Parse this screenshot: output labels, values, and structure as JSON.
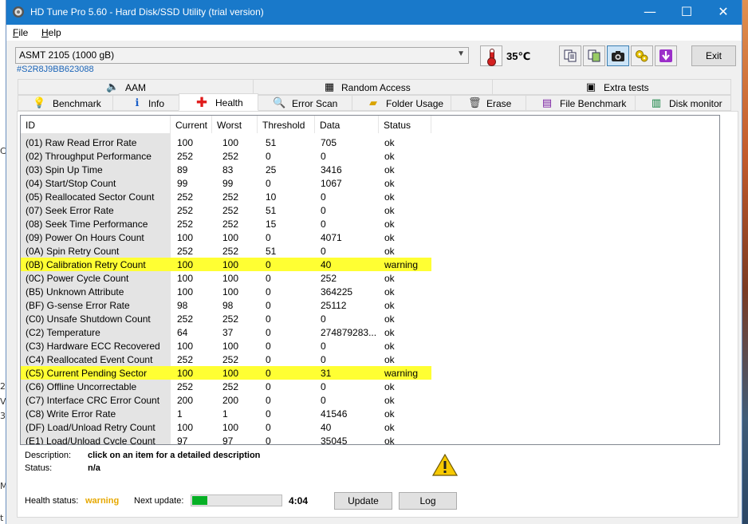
{
  "window": {
    "title": "HD Tune Pro 5.60 - Hard Disk/SSD Utility (trial version)",
    "minimize": "—",
    "maximize": "☐",
    "close": "✕"
  },
  "menu": {
    "file": "File",
    "help": "Help"
  },
  "drive": {
    "name": "ASMT    2105 (1000 gB)",
    "serial": "#S2R8J9BB623088",
    "temperature": "35℃"
  },
  "toolbar": {
    "exit_label": "Exit"
  },
  "tabs_top": [
    {
      "label": "AAM",
      "icon": "speaker-icon"
    },
    {
      "label": "Random Access",
      "icon": "random-access-icon"
    },
    {
      "label": "Extra tests",
      "icon": "extra-tests-icon"
    }
  ],
  "tabs_bottom": [
    {
      "label": "Benchmark",
      "icon": "lightbulb-icon"
    },
    {
      "label": "Info",
      "icon": "info-icon"
    },
    {
      "label": "Health",
      "icon": "health-cross-icon",
      "active": true
    },
    {
      "label": "Error Scan",
      "icon": "magnifier-icon"
    },
    {
      "label": "Folder Usage",
      "icon": "folder-icon"
    },
    {
      "label": "Erase",
      "icon": "trash-icon"
    },
    {
      "label": "File Benchmark",
      "icon": "file-benchmark-icon"
    },
    {
      "label": "Disk monitor",
      "icon": "disk-monitor-icon"
    }
  ],
  "grid": {
    "headers": [
      "ID",
      "Current",
      "Worst",
      "Threshold",
      "Data",
      "Status"
    ],
    "rows": [
      [
        "(01) Raw Read Error Rate",
        "100",
        "100",
        "51",
        "705",
        "ok"
      ],
      [
        "(02) Throughput Performance",
        "252",
        "252",
        "0",
        "0",
        "ok"
      ],
      [
        "(03) Spin Up Time",
        "89",
        "83",
        "25",
        "3416",
        "ok"
      ],
      [
        "(04) Start/Stop Count",
        "99",
        "99",
        "0",
        "1067",
        "ok"
      ],
      [
        "(05) Reallocated Sector Count",
        "252",
        "252",
        "10",
        "0",
        "ok"
      ],
      [
        "(07) Seek Error Rate",
        "252",
        "252",
        "51",
        "0",
        "ok"
      ],
      [
        "(08) Seek Time Performance",
        "252",
        "252",
        "15",
        "0",
        "ok"
      ],
      [
        "(09) Power On Hours Count",
        "100",
        "100",
        "0",
        "4071",
        "ok"
      ],
      [
        "(0A) Spin Retry Count",
        "252",
        "252",
        "51",
        "0",
        "ok"
      ],
      [
        "(0B) Calibration Retry Count",
        "100",
        "100",
        "0",
        "40",
        "warning"
      ],
      [
        "(0C) Power Cycle Count",
        "100",
        "100",
        "0",
        "252",
        "ok"
      ],
      [
        "(B5) Unknown Attribute",
        "100",
        "100",
        "0",
        "364225",
        "ok"
      ],
      [
        "(BF) G-sense Error Rate",
        "98",
        "98",
        "0",
        "25112",
        "ok"
      ],
      [
        "(C0) Unsafe Shutdown Count",
        "252",
        "252",
        "0",
        "0",
        "ok"
      ],
      [
        "(C2) Temperature",
        "64",
        "37",
        "0",
        "274879283...",
        "ok"
      ],
      [
        "(C3) Hardware ECC Recovered",
        "100",
        "100",
        "0",
        "0",
        "ok"
      ],
      [
        "(C4) Reallocated Event Count",
        "252",
        "252",
        "0",
        "0",
        "ok"
      ],
      [
        "(C5) Current Pending Sector",
        "100",
        "100",
        "0",
        "31",
        "warning"
      ],
      [
        "(C6) Offline Uncorrectable",
        "252",
        "252",
        "0",
        "0",
        "ok"
      ],
      [
        "(C7) Interface CRC Error Count",
        "200",
        "200",
        "0",
        "0",
        "ok"
      ],
      [
        "(C8) Write Error Rate",
        "1",
        "1",
        "0",
        "41546",
        "ok"
      ],
      [
        "(DF) Load/Unload Retry Count",
        "100",
        "100",
        "0",
        "40",
        "ok"
      ],
      [
        "(E1) Load/Unload Cycle Count",
        "97",
        "97",
        "0",
        "35045",
        "ok"
      ]
    ],
    "warning_color": "#ffff33"
  },
  "description": {
    "label": "Description:",
    "value": "click on an item for a detailed description",
    "status_label": "Status:",
    "status_value": "n/a"
  },
  "footer": {
    "health_label": "Health status:",
    "health_value": "warning",
    "next_update_label": "Next update:",
    "progress": 0.17,
    "countdown": "4:04",
    "update_button": "Update",
    "log_button": "Log"
  },
  "colors": {
    "titlebar": "#1979ca",
    "serial": "#1a64b8",
    "warning_text": "#e6a800",
    "progress": "#06b025"
  },
  "desktop": {
    "edge_chars": [
      "C",
      "20",
      "V",
      "3",
      "M",
      "t"
    ]
  }
}
